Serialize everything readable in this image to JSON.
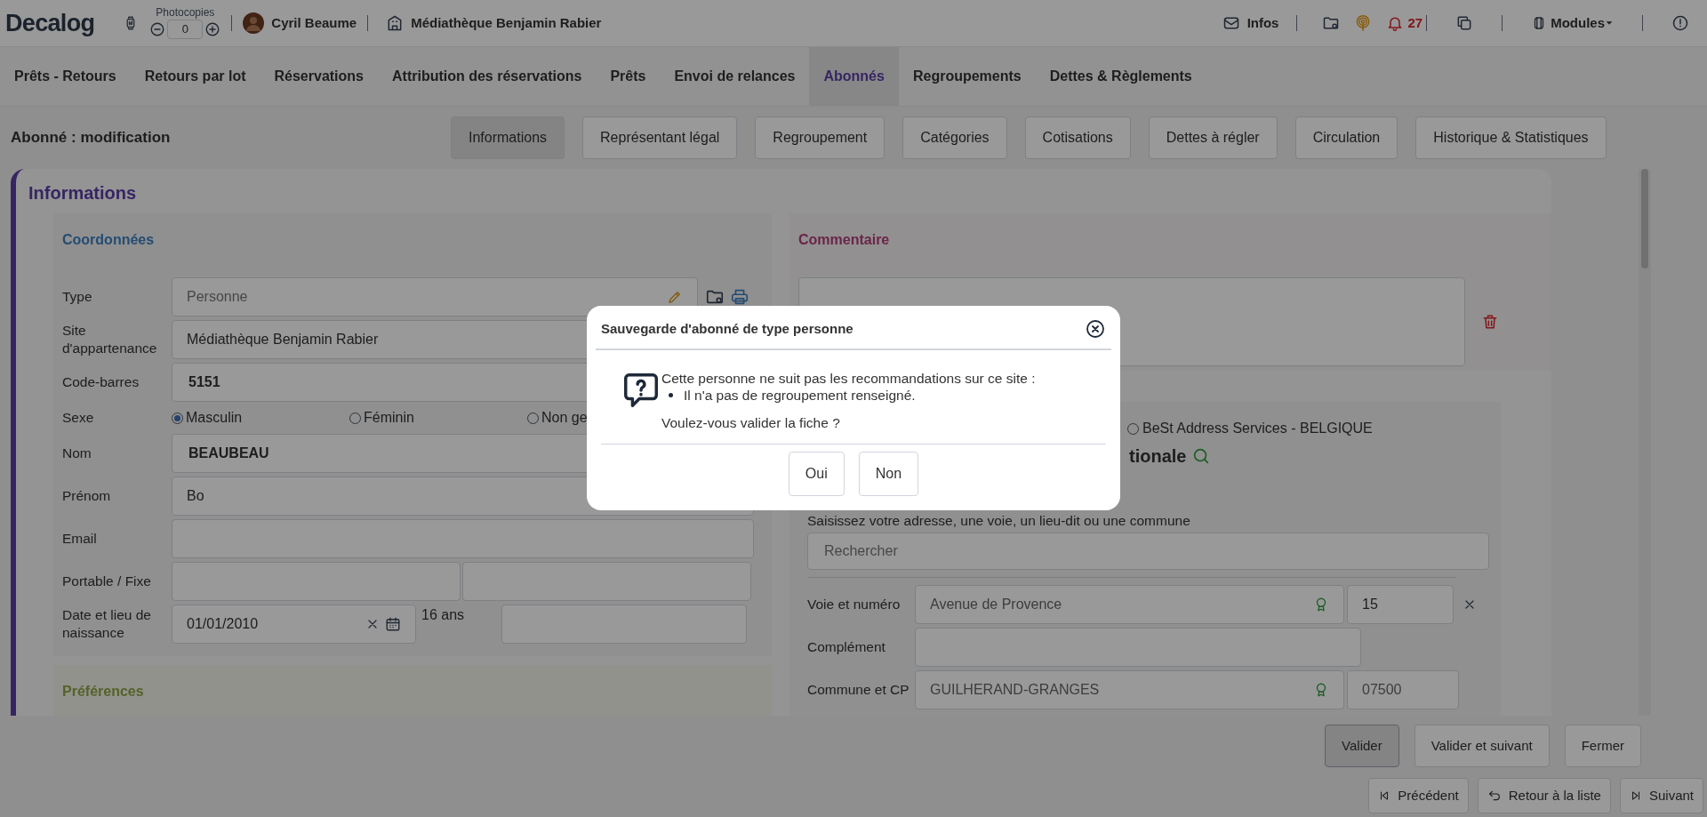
{
  "header": {
    "logo": "Decalog",
    "photocopies_label": "Photocopies",
    "photocopies_count": "0",
    "user": "Cyril Beaume",
    "site": "Médiathèque Benjamin Rabier",
    "infos": "Infos",
    "notifications": "27",
    "modules": "Modules"
  },
  "nav_tabs": [
    {
      "label": "Prêts - Retours",
      "selected": false
    },
    {
      "label": "Retours par lot",
      "selected": false
    },
    {
      "label": "Réservations",
      "selected": false
    },
    {
      "label": "Attribution des réservations",
      "selected": false
    },
    {
      "label": "Prêts",
      "selected": false
    },
    {
      "label": "Envoi de relances",
      "selected": false
    },
    {
      "label": "Abonnés",
      "selected": true
    },
    {
      "label": "Regroupements",
      "selected": false
    },
    {
      "label": "Dettes & Règlements",
      "selected": false
    }
  ],
  "page_title": "Abonné : modification",
  "section_tabs": [
    {
      "label": "Informations",
      "selected": true
    },
    {
      "label": "Représentant légal",
      "selected": false
    },
    {
      "label": "Regroupement",
      "selected": false
    },
    {
      "label": "Catégories",
      "selected": false
    },
    {
      "label": "Cotisations",
      "selected": false
    },
    {
      "label": "Dettes à régler",
      "selected": false
    },
    {
      "label": "Circulation",
      "selected": false
    },
    {
      "label": "Historique & Statistiques",
      "selected": false
    }
  ],
  "card_title": "Informations",
  "coordonnees": {
    "title": "Coordonnées",
    "fields": [
      {
        "kind": "type",
        "label": "Type",
        "value": "Personne"
      },
      {
        "kind": "text",
        "label": "Site d'appartenance",
        "value": "Médiathèque Benjamin Rabier",
        "bold": false
      },
      {
        "kind": "text",
        "label": "Code-barres",
        "value": "5151",
        "bold": true
      },
      {
        "kind": "radio",
        "label": "Sexe",
        "options": [
          {
            "label": "Masculin",
            "selected": true
          },
          {
            "label": "Féminin",
            "selected": false
          },
          {
            "label": "Non ge",
            "selected": false
          }
        ]
      },
      {
        "kind": "text",
        "label": "Nom",
        "value": "BEAUBEAU",
        "bold": true
      },
      {
        "kind": "text",
        "label": "Prénom",
        "value": "Bo",
        "bold": false
      },
      {
        "kind": "text",
        "label": "Email"
      },
      {
        "kind": "pair",
        "label": "Portable / Fixe"
      },
      {
        "kind": "birth",
        "label": "Date et lieu de naissance",
        "value": "01/01/2010",
        "age": "16 ans"
      }
    ]
  },
  "preferences": {
    "title": "Préférences"
  },
  "commentaire": {
    "title": "Commentaire"
  },
  "adresse": {
    "option": {
      "label": "BeSt Address Services - BELGIQUE",
      "selected": false
    },
    "heading": "tionale",
    "hint": "Saisissez votre adresse, une voie, un lieu-dit ou une commune",
    "search_placeholder": "Rechercher",
    "fields": [
      {
        "kind": "street",
        "label": "Voie et numéro",
        "value": "Avenue de Provence",
        "number": "15"
      },
      {
        "kind": "text",
        "label": "Complément"
      },
      {
        "kind": "city",
        "label": "Commune et CP",
        "value": "GUILHERAND-GRANGES",
        "postcode": "07500"
      }
    ]
  },
  "actions": [
    {
      "label": "Valider",
      "focused": true
    },
    {
      "label": "Valider et suivant",
      "focused": false
    },
    {
      "label": "Fermer",
      "focused": false
    }
  ],
  "navigation": [
    {
      "kind": "previous",
      "label": "Précédent"
    },
    {
      "kind": "back",
      "label": "Retour à la liste"
    },
    {
      "kind": "next",
      "label": "Suivant"
    }
  ],
  "dialog": {
    "title": "Sauvegarde d'abonné de type personne",
    "message": "Cette personne ne suit pas les recommandations sur ce site :",
    "bullets": [
      "Il n'a pas de regroupement renseigné."
    ],
    "question": "Voulez-vous valider la fiche ?",
    "buttons": [
      "Oui",
      "Non"
    ]
  }
}
